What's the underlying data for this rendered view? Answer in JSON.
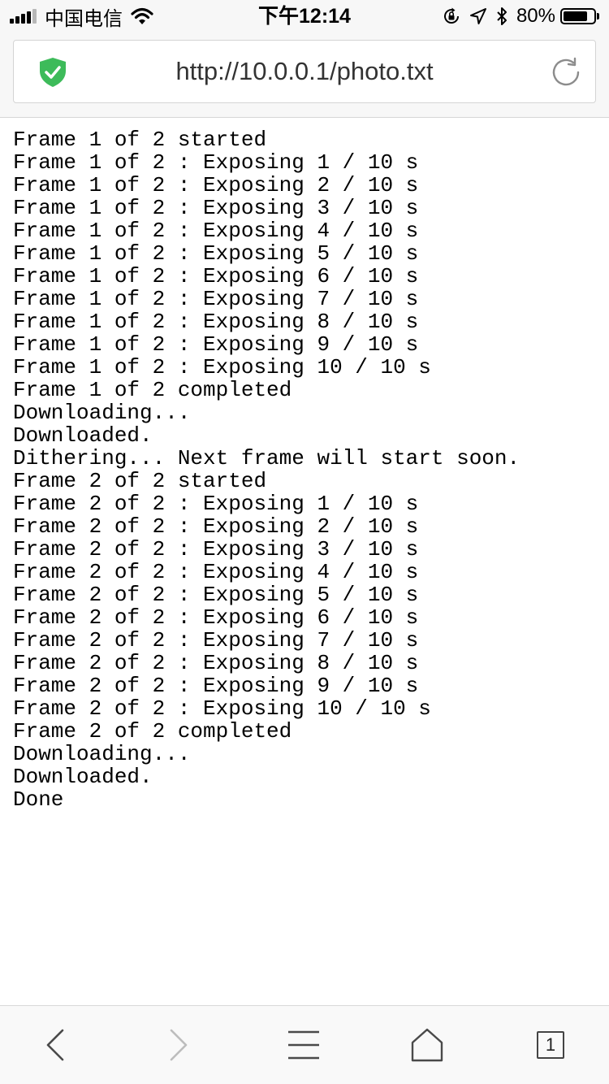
{
  "status_bar": {
    "carrier": "中国电信",
    "time": "下午12:14",
    "battery_percent_label": "80%",
    "battery_level": 0.8,
    "icons": [
      "signal-icon",
      "wifi-icon",
      "rotation-lock-icon",
      "location-icon",
      "bluetooth-icon",
      "battery-icon"
    ]
  },
  "address_bar": {
    "url": "http://10.0.0.1/photo.txt",
    "secure_icon": "shield-check-icon",
    "reload_icon": "reload-icon",
    "shield_color": "#3dbb5a"
  },
  "content": {
    "lines": [
      "Frame 1 of 2 started",
      "Frame 1 of 2 : Exposing 1 / 10 s",
      "Frame 1 of 2 : Exposing 2 / 10 s",
      "Frame 1 of 2 : Exposing 3 / 10 s",
      "Frame 1 of 2 : Exposing 4 / 10 s",
      "Frame 1 of 2 : Exposing 5 / 10 s",
      "Frame 1 of 2 : Exposing 6 / 10 s",
      "Frame 1 of 2 : Exposing 7 / 10 s",
      "Frame 1 of 2 : Exposing 8 / 10 s",
      "Frame 1 of 2 : Exposing 9 / 10 s",
      "Frame 1 of 2 : Exposing 10 / 10 s",
      "Frame 1 of 2 completed",
      "Downloading...",
      "Downloaded.",
      "Dithering... Next frame will start soon.",
      "Frame 2 of 2 started",
      "Frame 2 of 2 : Exposing 1 / 10 s",
      "Frame 2 of 2 : Exposing 2 / 10 s",
      "Frame 2 of 2 : Exposing 3 / 10 s",
      "Frame 2 of 2 : Exposing 4 / 10 s",
      "Frame 2 of 2 : Exposing 5 / 10 s",
      "Frame 2 of 2 : Exposing 6 / 10 s",
      "Frame 2 of 2 : Exposing 7 / 10 s",
      "Frame 2 of 2 : Exposing 8 / 10 s",
      "Frame 2 of 2 : Exposing 9 / 10 s",
      "Frame 2 of 2 : Exposing 10 / 10 s",
      "Frame 2 of 2 completed",
      "Downloading...",
      "Downloaded.",
      "Done"
    ]
  },
  "toolbar": {
    "back_icon": "back-arrow-icon",
    "forward_icon": "forward-arrow-icon",
    "menu_icon": "menu-icon",
    "home_icon": "home-icon",
    "tabs_count": "1"
  }
}
